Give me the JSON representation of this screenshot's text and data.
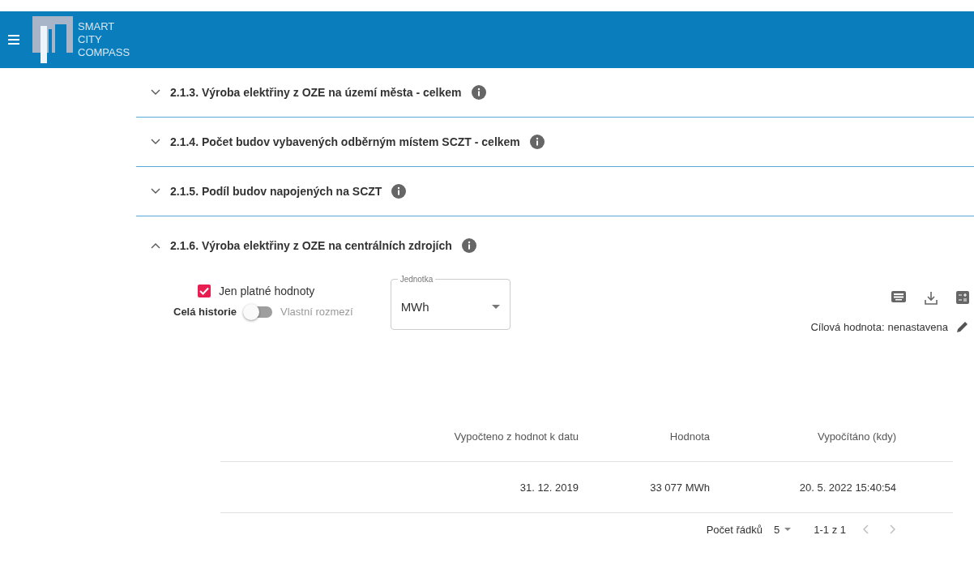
{
  "header": {
    "logo_lines": [
      "SMART",
      "CITY",
      "COMPASS"
    ]
  },
  "sections": [
    {
      "title": "2.1.3. Výroba elektřiny z OZE na území města - celkem",
      "expanded": false
    },
    {
      "title": "2.1.4. Počet budov vybavených odběrným místem SCZT - celkem",
      "expanded": false
    },
    {
      "title": "2.1.5. Podíl budov napojených na SCZT",
      "expanded": false
    },
    {
      "title": "2.1.6. Výroba elektřiny z OZE na centrálních zdrojích",
      "expanded": true
    }
  ],
  "filters": {
    "valid_only": {
      "label": "Jen platné hodnoty",
      "checked": true
    },
    "range": {
      "left_label": "Celá historie",
      "right_label": "Vlastní rozmezí",
      "on": false
    },
    "unit": {
      "label": "Jednotka",
      "value": "MWh"
    }
  },
  "target": {
    "label": "Cílová hodnota:",
    "value": "nenastavena"
  },
  "table": {
    "columns": [
      "Vypočteno z hodnot k datu",
      "Hodnota",
      "Vypočítáno (kdy)"
    ],
    "rows": [
      [
        "31. 12. 2019",
        "33 077 MWh",
        "20. 5. 2022 15:40:54"
      ]
    ]
  },
  "pagination": {
    "rows_label": "Počet řádků",
    "rows_value": "5",
    "range": "1-1 z 1",
    "prev_disabled": true,
    "next_disabled": true
  }
}
